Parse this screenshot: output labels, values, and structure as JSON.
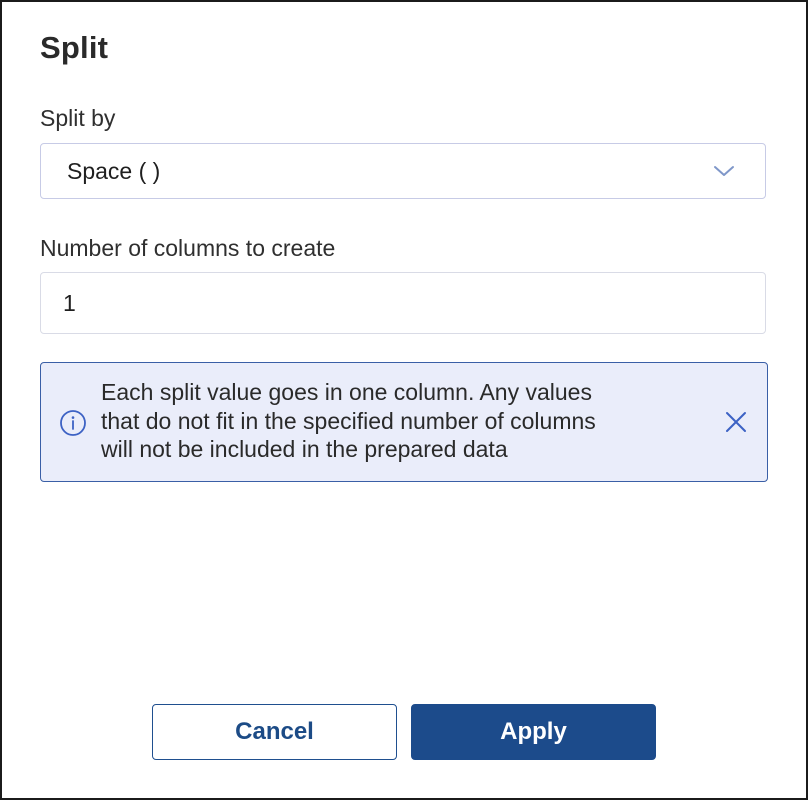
{
  "dialog": {
    "title": "Split"
  },
  "split_by": {
    "label": "Split by",
    "selected": "Space ( )",
    "icon": "chevron-down-icon"
  },
  "columns": {
    "label": "Number of columns to create",
    "value": "1"
  },
  "info_banner": {
    "line1": "Each split value goes in one column. Any values",
    "line2": "that do not fit in the specified number of columns",
    "line3": "will not be included in the prepared data",
    "icon": "info-icon",
    "close_icon": "close-icon",
    "accent_color": "#3a5fa6",
    "background_color": "#eaedfa"
  },
  "actions": {
    "cancel_label": "Cancel",
    "apply_label": "Apply",
    "primary_color": "#1c4b8b"
  }
}
